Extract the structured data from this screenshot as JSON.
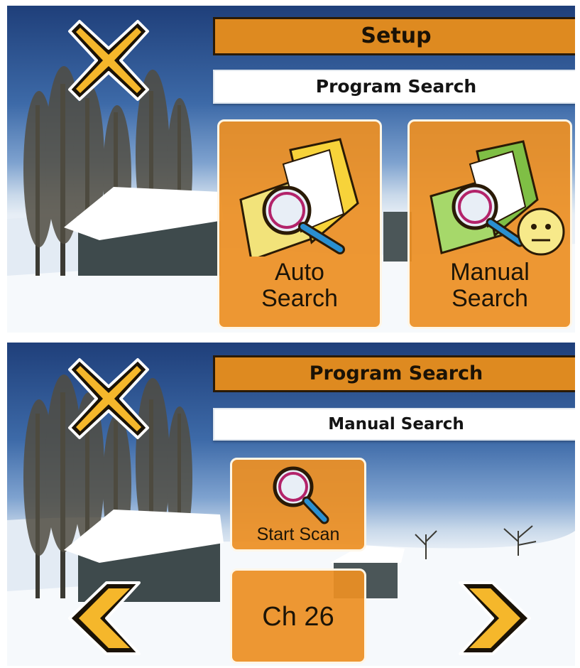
{
  "setup_screen": {
    "title": "Setup",
    "subtitle": "Program Search",
    "close_icon": "close-icon",
    "options": [
      {
        "label_line1": "Auto",
        "label_line2": "Search",
        "icon": "folder-search-icon"
      },
      {
        "label_line1": "Manual",
        "label_line2": "Search",
        "icon": "manual-folder-search-icon"
      }
    ]
  },
  "manual_search_screen": {
    "title": "Program Search",
    "subtitle": "Manual Search",
    "close_icon": "close-icon",
    "start_scan_label": "Start Scan",
    "channel_label": "Ch 26",
    "prev_icon": "chevron-left-icon",
    "next_icon": "chevron-right-icon"
  },
  "colors": {
    "accent_orange": "#de8a20",
    "button_yellow": "#f5b72b",
    "outline": "#1a1206",
    "sky": "#3d6aa8",
    "snow": "#f4f7fb"
  }
}
